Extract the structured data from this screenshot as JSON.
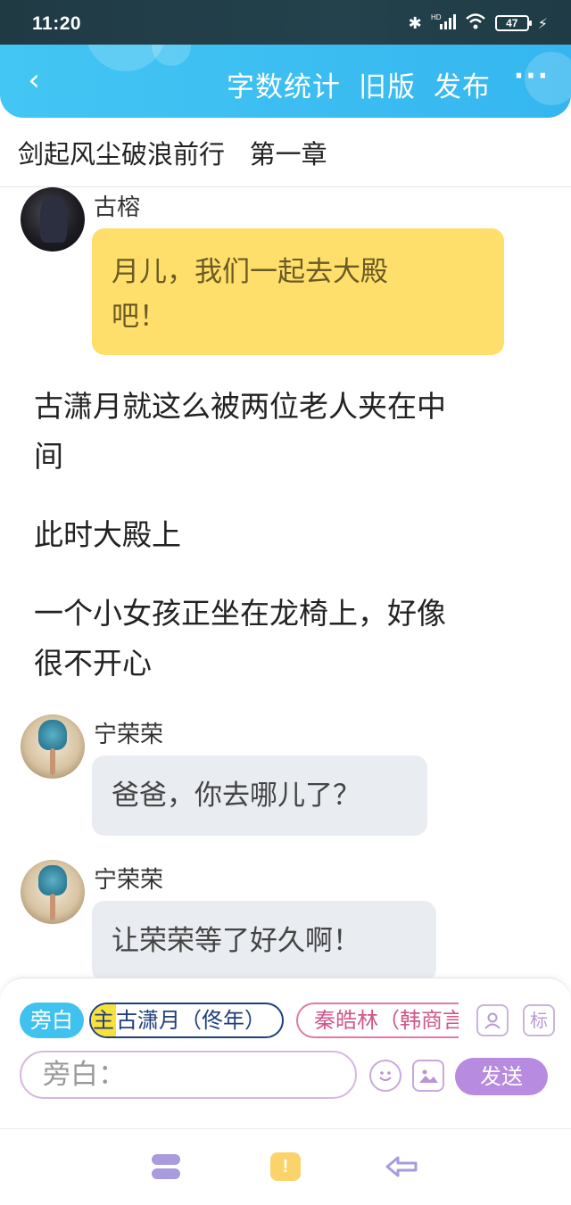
{
  "status_bar": {
    "time": "11:20",
    "battery": "47",
    "icons": [
      "bluetooth-icon",
      "hd-signal-icon",
      "wifi-icon",
      "battery-icon",
      "charging-icon"
    ]
  },
  "header": {
    "back_icon": "chevron-left-icon",
    "actions": [
      "字数统计",
      "旧版",
      "发布"
    ],
    "more_icon": "more-dots-icon",
    "color": "#3bbef1"
  },
  "chapter_title": "剑起风尘破浪前行   第一章",
  "messages": [
    {
      "speaker": "古榕",
      "lines": [
        "月儿，我们一起去大殿",
        "吧！"
      ],
      "style": "yellow"
    },
    {
      "narration": [
        "古潇月就这么被两位老人夹在中",
        "间"
      ]
    },
    {
      "narration": [
        "此时大殿上"
      ]
    },
    {
      "narration": [
        "一个小女孩正坐在龙椅上，好像",
        "很不开心"
      ]
    },
    {
      "speaker": "宁荣荣",
      "lines": [
        "爸爸，你去哪儿了？"
      ],
      "style": "gray"
    },
    {
      "speaker": "宁荣荣",
      "lines": [
        "让荣荣等了好久啊！"
      ],
      "style": "gray"
    }
  ],
  "input_panel": {
    "chips": {
      "narrator": "旁白",
      "main_tag": "主",
      "main_name": "古潇月（佟年）",
      "other": "秦皓林（韩商言"
    },
    "icon_buttons": [
      "contact-icon",
      "标"
    ],
    "input_placeholder": "旁白：",
    "emoji_icon": "emoji-icon",
    "image_icon": "image-icon",
    "send": "发送"
  },
  "bottom_nav": [
    "menu-icon",
    "alert-icon",
    "back-arrow-icon"
  ]
}
